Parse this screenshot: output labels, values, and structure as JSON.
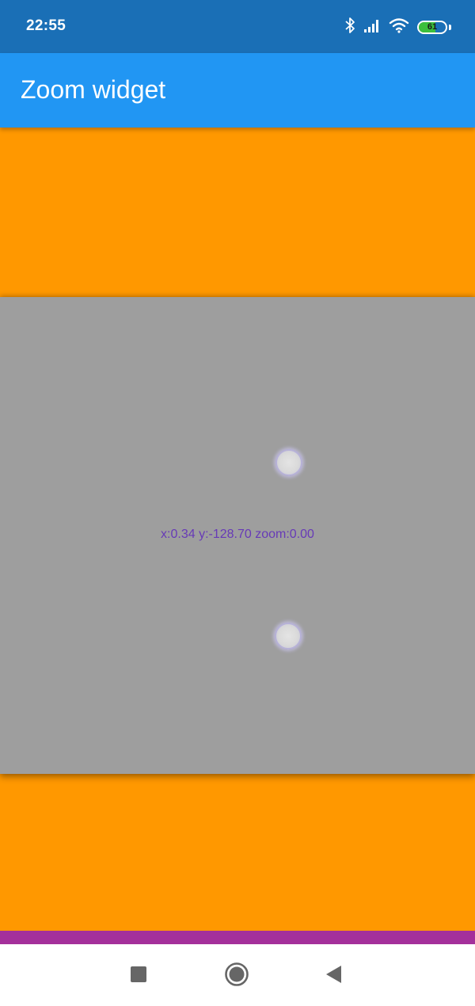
{
  "status_bar": {
    "time": "22:55",
    "battery_level": "61",
    "battery_fraction": 0.61,
    "icons": [
      "bluetooth-icon",
      "signal-icon",
      "wifi-icon",
      "battery-icon"
    ]
  },
  "app_bar": {
    "title": "Zoom widget"
  },
  "zoom_widget": {
    "readout": "x:0.34 y:-128.70 zoom:0.00",
    "touch_points": 2
  },
  "nav_bar": {
    "buttons": [
      "recents",
      "home",
      "back"
    ]
  },
  "colors": {
    "status_bar": "#1a6fb6",
    "app_bar": "#2196f3",
    "background": "#ff9800",
    "zoom_area": "#9e9e9e",
    "readout_text": "#673ab7",
    "purple_strip": "#a4309b",
    "nav_bar": "#ffffff"
  }
}
